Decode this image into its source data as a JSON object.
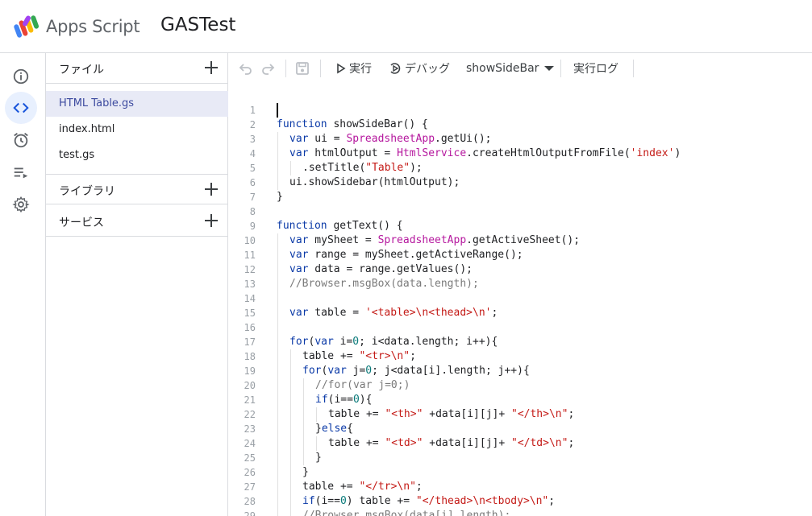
{
  "header": {
    "app_name": "Apps Script",
    "project_name": "GASTest"
  },
  "rail": {
    "items": [
      {
        "name": "overview",
        "icon": "info-icon"
      },
      {
        "name": "editor",
        "icon": "code-icon",
        "active": true
      },
      {
        "name": "triggers",
        "icon": "alarm-icon"
      },
      {
        "name": "executions",
        "icon": "list-play-icon"
      },
      {
        "name": "settings",
        "icon": "gear-icon"
      }
    ]
  },
  "files_panel": {
    "files_title": "ファイル",
    "files": [
      {
        "name": "HTML Table.gs",
        "active": true
      },
      {
        "name": "index.html"
      },
      {
        "name": "test.gs"
      }
    ],
    "libraries_title": "ライブラリ",
    "services_title": "サービス"
  },
  "toolbar": {
    "run_label": "実行",
    "debug_label": "デバッグ",
    "function_select": "showSideBar",
    "log_label": "実行ログ"
  },
  "colors": {
    "accent": "#e8f0fe",
    "active_file_bg": "#e8eaf6",
    "keyword": "#0b3aa7",
    "class": "#b5179e",
    "string": "#c41a16",
    "number": "#0a7a7a",
    "comment": "#7a7a7a"
  },
  "code": {
    "lines": [
      {
        "n": "1",
        "indent": 0,
        "guides": 0,
        "t": []
      },
      {
        "n": "2",
        "indent": 0,
        "guides": 0,
        "t": [
          [
            "kw",
            "function"
          ],
          [
            "",
            "showSideBar() {"
          ]
        ]
      },
      {
        "n": "3",
        "indent": 1,
        "guides": 1,
        "t": [
          [
            "kw",
            "var"
          ],
          [
            "",
            " ui = "
          ],
          [
            "cls",
            "SpreadsheetApp"
          ],
          [
            "",
            ".getUi();"
          ]
        ]
      },
      {
        "n": "4",
        "indent": 1,
        "guides": 1,
        "t": [
          [
            "kw",
            "var"
          ],
          [
            "",
            " htmlOutput = "
          ],
          [
            "cls",
            "HtmlService"
          ],
          [
            "",
            ".createHtmlOutputFromFile("
          ],
          [
            "str",
            "'index'"
          ],
          [
            "",
            ")"
          ]
        ]
      },
      {
        "n": "5",
        "indent": 2,
        "guides": 2,
        "t": [
          [
            "",
            ".setTitle("
          ],
          [
            "str",
            "\"Table\""
          ],
          [
            "",
            ");"
          ]
        ]
      },
      {
        "n": "6",
        "indent": 1,
        "guides": 1,
        "t": [
          [
            "",
            "ui.showSidebar(htmlOutput);"
          ]
        ]
      },
      {
        "n": "7",
        "indent": 0,
        "guides": 0,
        "t": [
          [
            "",
            "}"
          ]
        ]
      },
      {
        "n": "8",
        "indent": 0,
        "guides": 0,
        "t": []
      },
      {
        "n": "9",
        "indent": 0,
        "guides": 0,
        "t": [
          [
            "kw",
            "function"
          ],
          [
            "",
            " getText() {"
          ]
        ]
      },
      {
        "n": "10",
        "indent": 1,
        "guides": 1,
        "t": [
          [
            "kw",
            "var"
          ],
          [
            "",
            " mySheet = "
          ],
          [
            "cls",
            "SpreadsheetApp"
          ],
          [
            "",
            ".getActiveSheet();"
          ]
        ]
      },
      {
        "n": "11",
        "indent": 1,
        "guides": 1,
        "t": [
          [
            "kw",
            "var"
          ],
          [
            "",
            " range = mySheet.getActiveRange();"
          ]
        ]
      },
      {
        "n": "12",
        "indent": 1,
        "guides": 1,
        "t": [
          [
            "kw",
            "var"
          ],
          [
            "",
            " data = range.getValues();"
          ]
        ]
      },
      {
        "n": "13",
        "indent": 1,
        "guides": 1,
        "t": [
          [
            "cm",
            "//Browser.msgBox(data.length);"
          ]
        ]
      },
      {
        "n": "14",
        "indent": 1,
        "guides": 1,
        "t": []
      },
      {
        "n": "15",
        "indent": 1,
        "guides": 1,
        "t": [
          [
            "kw",
            "var"
          ],
          [
            "",
            " table = "
          ],
          [
            "str",
            "'<table>\\n<thead>\\n'"
          ],
          [
            "",
            ";"
          ]
        ]
      },
      {
        "n": "16",
        "indent": 1,
        "guides": 1,
        "t": []
      },
      {
        "n": "17",
        "indent": 1,
        "guides": 1,
        "t": [
          [
            "kw",
            "for"
          ],
          [
            "",
            "("
          ],
          [
            "kw",
            "var"
          ],
          [
            "",
            " i="
          ],
          [
            "num",
            "0"
          ],
          [
            "",
            "; i<data.length; i++){"
          ]
        ]
      },
      {
        "n": "18",
        "indent": 2,
        "guides": 2,
        "t": [
          [
            "",
            "table += "
          ],
          [
            "str",
            "\"<tr>\\n\""
          ],
          [
            "",
            ";"
          ]
        ]
      },
      {
        "n": "19",
        "indent": 2,
        "guides": 2,
        "t": [
          [
            "kw",
            "for"
          ],
          [
            "",
            "("
          ],
          [
            "kw",
            "var"
          ],
          [
            "",
            " j="
          ],
          [
            "num",
            "0"
          ],
          [
            "",
            "; j<data[i].length; j++){"
          ]
        ]
      },
      {
        "n": "20",
        "indent": 3,
        "guides": 3,
        "t": [
          [
            "cm",
            "//for(var j=0;)"
          ]
        ]
      },
      {
        "n": "21",
        "indent": 3,
        "guides": 3,
        "t": [
          [
            "kw",
            "if"
          ],
          [
            "",
            "(i=="
          ],
          [
            "num",
            "0"
          ],
          [
            "",
            "){"
          ]
        ]
      },
      {
        "n": "22",
        "indent": 4,
        "guides": 4,
        "t": [
          [
            "",
            "table += "
          ],
          [
            "str",
            "\"<th>\""
          ],
          [
            "",
            " +data[i][j]+ "
          ],
          [
            "str",
            "\"</th>\\n\""
          ],
          [
            "",
            ";"
          ]
        ]
      },
      {
        "n": "23",
        "indent": 3,
        "guides": 3,
        "t": [
          [
            "",
            "}"
          ],
          [
            "kw",
            "else"
          ],
          [
            "",
            "{"
          ]
        ]
      },
      {
        "n": "24",
        "indent": 4,
        "guides": 4,
        "t": [
          [
            "",
            "table += "
          ],
          [
            "str",
            "\"<td>\""
          ],
          [
            "",
            " +data[i][j]+ "
          ],
          [
            "str",
            "\"</td>\\n\""
          ],
          [
            "",
            ";"
          ]
        ]
      },
      {
        "n": "25",
        "indent": 3,
        "guides": 3,
        "t": [
          [
            "",
            "}"
          ]
        ]
      },
      {
        "n": "26",
        "indent": 2,
        "guides": 2,
        "t": [
          [
            "",
            "}"
          ]
        ]
      },
      {
        "n": "27",
        "indent": 2,
        "guides": 2,
        "t": [
          [
            "",
            "table += "
          ],
          [
            "str",
            "\"</tr>\\n\""
          ],
          [
            "",
            ";"
          ]
        ]
      },
      {
        "n": "28",
        "indent": 2,
        "guides": 2,
        "t": [
          [
            "kw",
            "if"
          ],
          [
            "",
            "(i=="
          ],
          [
            "num",
            "0"
          ],
          [
            "",
            ") table += "
          ],
          [
            "str",
            "\"</thead>\\n<tbody>\\n\""
          ],
          [
            "",
            ";"
          ]
        ]
      },
      {
        "n": "29",
        "indent": 2,
        "guides": 2,
        "t": [
          [
            "cm",
            "//Browser.msgBox(data[i].length);"
          ]
        ]
      }
    ]
  }
}
